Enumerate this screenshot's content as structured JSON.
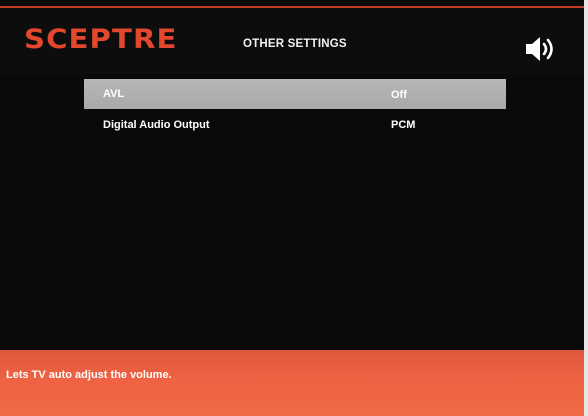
{
  "brand": {
    "logo_text": "SCEPTRE",
    "logo_color": "#e2482d"
  },
  "header": {
    "title": "OTHER SETTINGS",
    "status_icon": "speaker-volume-icon"
  },
  "settings": {
    "items": [
      {
        "label": "AVL",
        "value": "Off",
        "selected": true
      },
      {
        "label": "Digital Audio Output",
        "value": "PCM",
        "selected": false
      }
    ]
  },
  "help": {
    "text": "Lets TV auto adjust the volume."
  },
  "colors": {
    "background": "#0a0a0a",
    "selection": "#b0b0b0",
    "accent": "#ef6243"
  }
}
